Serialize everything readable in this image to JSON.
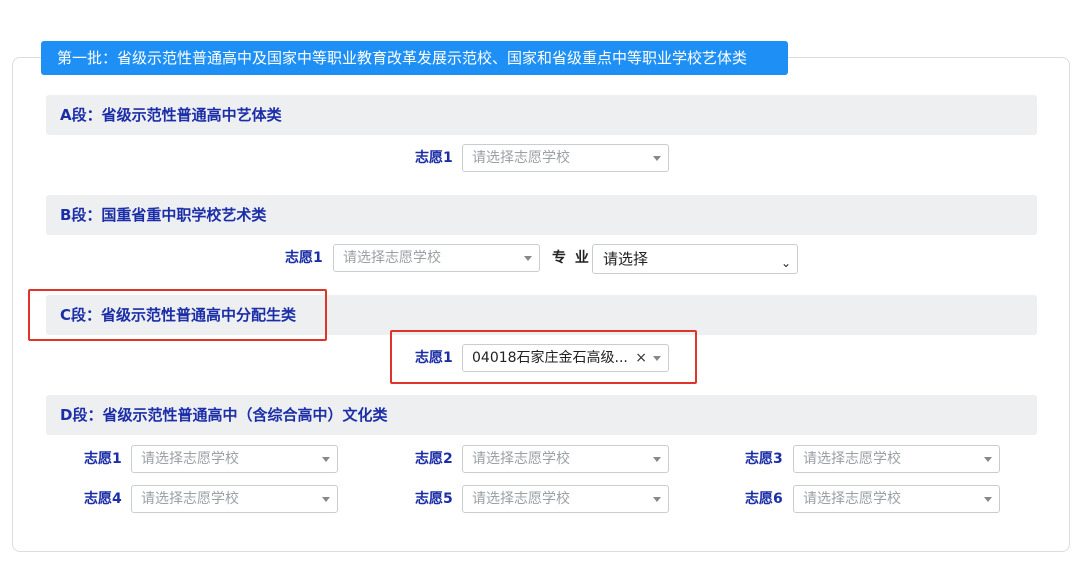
{
  "batch_title": "第一批：省级示范性普通高中及国家中等职业教育改革发展示范校、国家和省级重点中等职业学校艺体类",
  "sections": {
    "a": {
      "title": "A段：省级示范性普通高中艺体类"
    },
    "b": {
      "title": "B段：国重省重中职学校艺术类",
      "major_label": "专 业",
      "major_value": "请选择"
    },
    "c": {
      "title": "C段：省级示范性普通高中分配生类",
      "selected_value": "04018石家庄金石高级...",
      "clear": "×"
    },
    "d": {
      "title": "D段：省级示范性普通高中（含综合高中）文化类"
    }
  },
  "labels": {
    "choice1": "志愿1",
    "choice2": "志愿2",
    "choice3": "志愿3",
    "choice4": "志愿4",
    "choice5": "志愿5",
    "choice6": "志愿6"
  },
  "placeholder": "请选择志愿学校",
  "colors": {
    "accent": "#1e90f5",
    "label": "#1b2ea8",
    "highlight": "#e0342b"
  }
}
